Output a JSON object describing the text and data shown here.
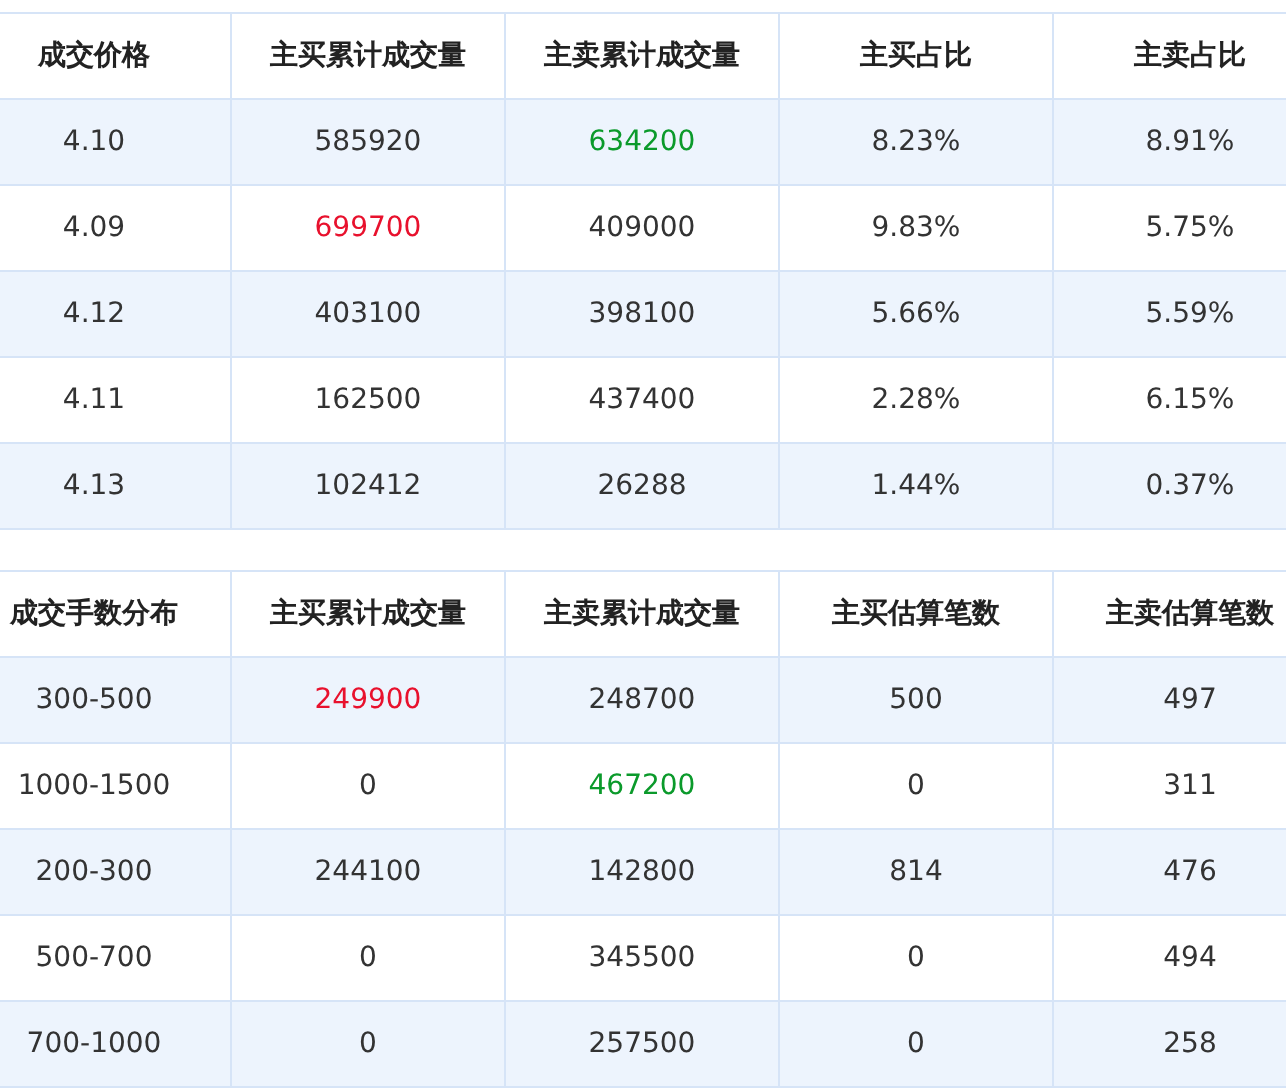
{
  "tables": [
    {
      "columns": [
        "成交价格",
        "主买累计成交量",
        "主卖累计成交量",
        "主买占比",
        "主卖占比"
      ],
      "rows": [
        [
          {
            "text": "4.10"
          },
          {
            "text": "585920"
          },
          {
            "text": "634200",
            "kind": "down"
          },
          {
            "text": "8.23%"
          },
          {
            "text": "8.91%"
          }
        ],
        [
          {
            "text": "4.09"
          },
          {
            "text": "699700",
            "kind": "up"
          },
          {
            "text": "409000"
          },
          {
            "text": "9.83%"
          },
          {
            "text": "5.75%"
          }
        ],
        [
          {
            "text": "4.12"
          },
          {
            "text": "403100"
          },
          {
            "text": "398100"
          },
          {
            "text": "5.66%"
          },
          {
            "text": "5.59%"
          }
        ],
        [
          {
            "text": "4.11"
          },
          {
            "text": "162500"
          },
          {
            "text": "437400"
          },
          {
            "text": "2.28%"
          },
          {
            "text": "6.15%"
          }
        ],
        [
          {
            "text": "4.13"
          },
          {
            "text": "102412"
          },
          {
            "text": "26288"
          },
          {
            "text": "1.44%"
          },
          {
            "text": "0.37%"
          }
        ]
      ]
    },
    {
      "columns": [
        "成交手数分布",
        "主买累计成交量",
        "主卖累计成交量",
        "主买估算笔数",
        "主卖估算笔数"
      ],
      "rows": [
        [
          {
            "text": "300-500"
          },
          {
            "text": "249900",
            "kind": "up"
          },
          {
            "text": "248700"
          },
          {
            "text": "500"
          },
          {
            "text": "497"
          }
        ],
        [
          {
            "text": "1000-1500"
          },
          {
            "text": "0"
          },
          {
            "text": "467200",
            "kind": "down"
          },
          {
            "text": "0"
          },
          {
            "text": "311"
          }
        ],
        [
          {
            "text": "200-300"
          },
          {
            "text": "244100"
          },
          {
            "text": "142800"
          },
          {
            "text": "814"
          },
          {
            "text": "476"
          }
        ],
        [
          {
            "text": "500-700"
          },
          {
            "text": "0"
          },
          {
            "text": "345500"
          },
          {
            "text": "0"
          },
          {
            "text": "494"
          }
        ],
        [
          {
            "text": "700-1000"
          },
          {
            "text": "0"
          },
          {
            "text": "257500"
          },
          {
            "text": "0"
          },
          {
            "text": "258"
          }
        ]
      ]
    }
  ]
}
